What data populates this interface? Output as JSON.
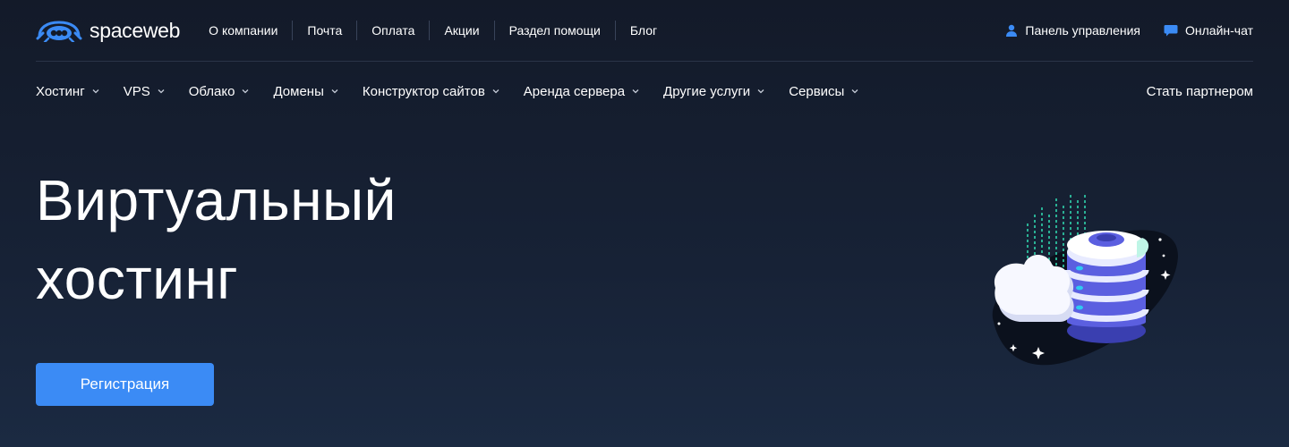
{
  "brand": {
    "name": "spaceweb",
    "accent": "#3b8bf5"
  },
  "top_nav": [
    {
      "label": "О компании"
    },
    {
      "label": "Почта"
    },
    {
      "label": "Оплата"
    },
    {
      "label": "Акции"
    },
    {
      "label": "Раздел помощи"
    },
    {
      "label": "Блог"
    }
  ],
  "top_right": {
    "panel": {
      "label": "Панель управления",
      "icon": "user-icon"
    },
    "chat": {
      "label": "Онлайн-чат",
      "icon": "chat-bubble-icon"
    }
  },
  "main_nav": [
    {
      "label": "Хостинг",
      "icon": "chevron-down-icon"
    },
    {
      "label": "VPS",
      "icon": "chevron-down-icon"
    },
    {
      "label": "Облако",
      "icon": "chevron-down-icon"
    },
    {
      "label": "Домены",
      "icon": "chevron-down-icon"
    },
    {
      "label": "Конструктор сайтов",
      "icon": "chevron-down-icon"
    },
    {
      "label": "Аренда сервера",
      "icon": "chevron-down-icon"
    },
    {
      "label": "Другие услуги",
      "icon": "chevron-down-icon"
    },
    {
      "label": "Сервисы",
      "icon": "chevron-down-icon"
    }
  ],
  "partner_label": "Стать партнером",
  "hero": {
    "title_line1": "Виртуальный",
    "title_line2": "хостинг",
    "cta_label": "Регистрация"
  }
}
